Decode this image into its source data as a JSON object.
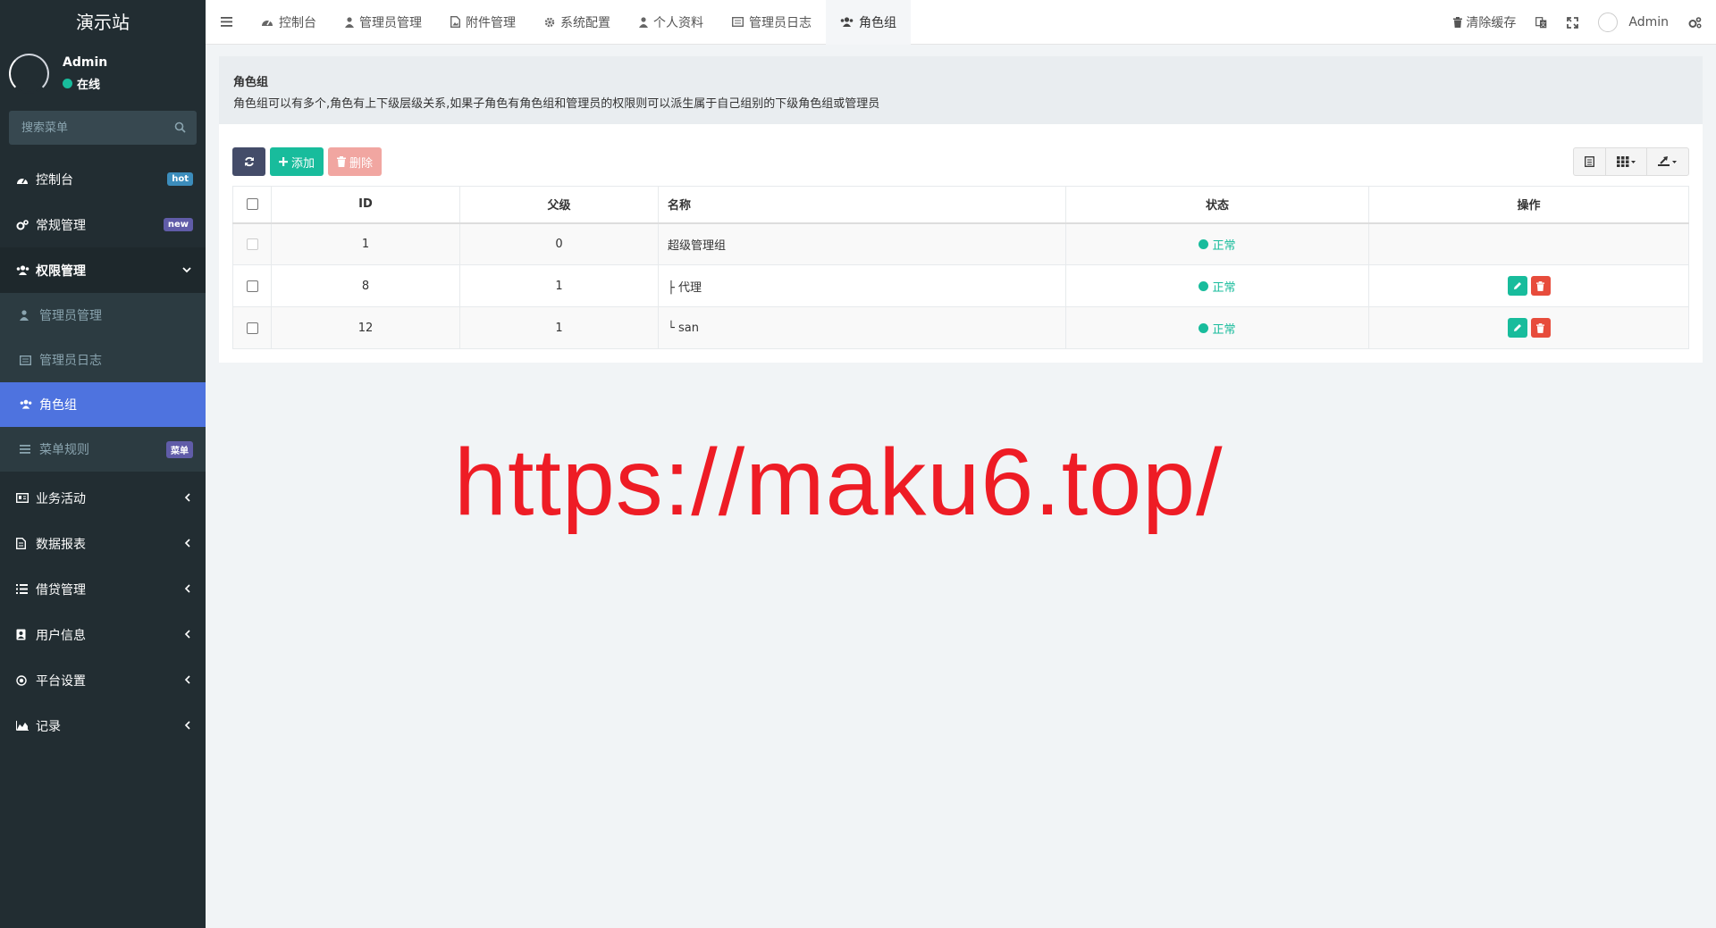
{
  "sidebar": {
    "logo": "演示站",
    "user": {
      "name": "Admin",
      "status": "在线"
    },
    "search": {
      "placeholder": "搜索菜单"
    },
    "items": [
      {
        "label": "控制台",
        "badge": "hot"
      },
      {
        "label": "常规管理",
        "badge": "new"
      },
      {
        "label": "权限管理"
      },
      {
        "label": "业务活动"
      },
      {
        "label": "数据报表"
      },
      {
        "label": "借贷管理"
      },
      {
        "label": "用户信息"
      },
      {
        "label": "平台设置"
      },
      {
        "label": "记录"
      }
    ],
    "subitems": [
      {
        "label": "管理员管理"
      },
      {
        "label": "管理员日志"
      },
      {
        "label": "角色组"
      },
      {
        "label": "菜单规则",
        "badge": "菜单"
      }
    ]
  },
  "topbar": {
    "tabs": [
      {
        "label": "控制台"
      },
      {
        "label": "管理员管理"
      },
      {
        "label": "附件管理"
      },
      {
        "label": "系统配置"
      },
      {
        "label": "个人资料"
      },
      {
        "label": "管理员日志"
      },
      {
        "label": "角色组"
      }
    ],
    "clear_cache": "清除缓存",
    "username": "Admin"
  },
  "content": {
    "title": "角色组",
    "description": "角色组可以有多个,角色有上下级层级关系,如果子角色有角色组和管理员的权限则可以派生属于自己组别的下级角色组或管理员",
    "buttons": {
      "add": "添加",
      "delete": "删除"
    },
    "table": {
      "headers": {
        "id": "ID",
        "pid": "父级",
        "name": "名称",
        "status": "状态",
        "operate": "操作"
      },
      "rows": [
        {
          "id": "1",
          "pid": "0",
          "name": "超级管理组",
          "status": "正常"
        },
        {
          "id": "8",
          "pid": "1",
          "name": "├ 代理",
          "status": "正常"
        },
        {
          "id": "12",
          "pid": "1",
          "name": "└ san",
          "status": "正常"
        }
      ]
    }
  },
  "watermark": "https://maku6.top/",
  "colors": {
    "sidebar": "#222d32",
    "active": "#4e73df",
    "success": "#18bc9c",
    "danger": "#e74c3c",
    "watermark": "#ee1c25"
  }
}
